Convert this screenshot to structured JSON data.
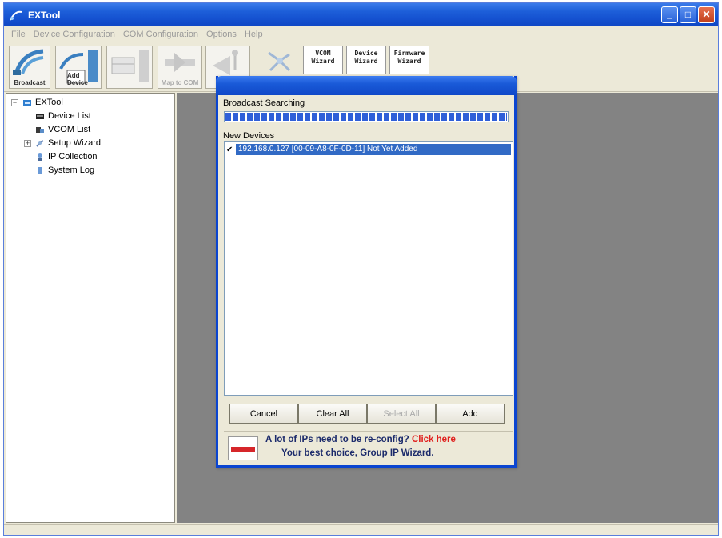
{
  "window": {
    "title": "EXTool"
  },
  "menu": {
    "items": [
      "File",
      "Device Configuration",
      "COM Configuration",
      "Options",
      "Help"
    ]
  },
  "toolbar": {
    "broadcast_label": "Broadcast",
    "add_device_label": "Add Device",
    "map_com_label": "Map to COM",
    "wizard_buttons": [
      {
        "line1": "VCOM",
        "line2": "Wizard"
      },
      {
        "line1": "Device",
        "line2": "Wizard"
      },
      {
        "line1": "Firmware",
        "line2": "Wizard"
      }
    ]
  },
  "tree": {
    "root": "EXTool",
    "items": [
      "Device List",
      "VCOM List",
      "Setup Wizard",
      "IP Collection",
      "System Log"
    ]
  },
  "dialog": {
    "section_broadcast": "Broadcast Searching",
    "progress": 1.0,
    "section_new_devices": "New Devices",
    "device_row": "192.168.0.127 [00-09-A8-0F-0D-11] Not Yet Added",
    "buttons": {
      "cancel": "Cancel",
      "clear_all": "Clear All",
      "select_all": "Select All",
      "add": "Add"
    },
    "promo": {
      "line1": "A lot of IPs need to be re-config?",
      "click_here": "Click here",
      "line2": "Your best choice, Group IP Wizard."
    }
  },
  "colors": {
    "title_bar": "#1d5fd9",
    "content_bg": "#838383",
    "selection": "#316ac5",
    "promo_text": "#1b2a6b",
    "click_here": "#e0201e"
  }
}
